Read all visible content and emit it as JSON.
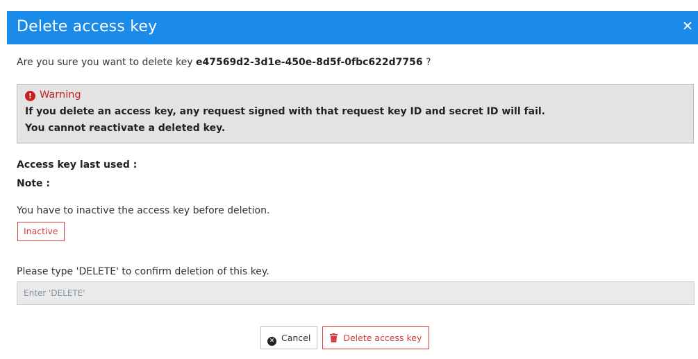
{
  "modal": {
    "title": "Delete access key",
    "close_icon": "close-icon",
    "header_color": "#1a8be8"
  },
  "confirm": {
    "prefix": "Are you sure you want to delete key",
    "key_id": "e47569d2-3d1e-450e-8d5f-0fbc622d7756",
    "suffix": "?"
  },
  "warning": {
    "icon": "exclamation-circle-icon",
    "title": "Warning",
    "line1": "If you delete an access key, any request signed with that request key ID and secret ID will fail.",
    "line2": "You cannot reactivate a deleted key.",
    "color": "#c9201f"
  },
  "details": {
    "last_used_label": "Access key last used :",
    "note_label": "Note :"
  },
  "inactive_section": {
    "message": "You have to inactive the access key before deletion.",
    "button_label": "Inactive"
  },
  "confirm_input": {
    "instruction": "Please type 'DELETE' to confirm deletion of this key.",
    "placeholder": "Enter 'DELETE'",
    "value": ""
  },
  "footer": {
    "cancel_label": "Cancel",
    "cancel_icon": "times-circle-icon",
    "delete_label": "Delete access key",
    "delete_icon": "trash-icon",
    "danger_color": "#d23c3c"
  }
}
